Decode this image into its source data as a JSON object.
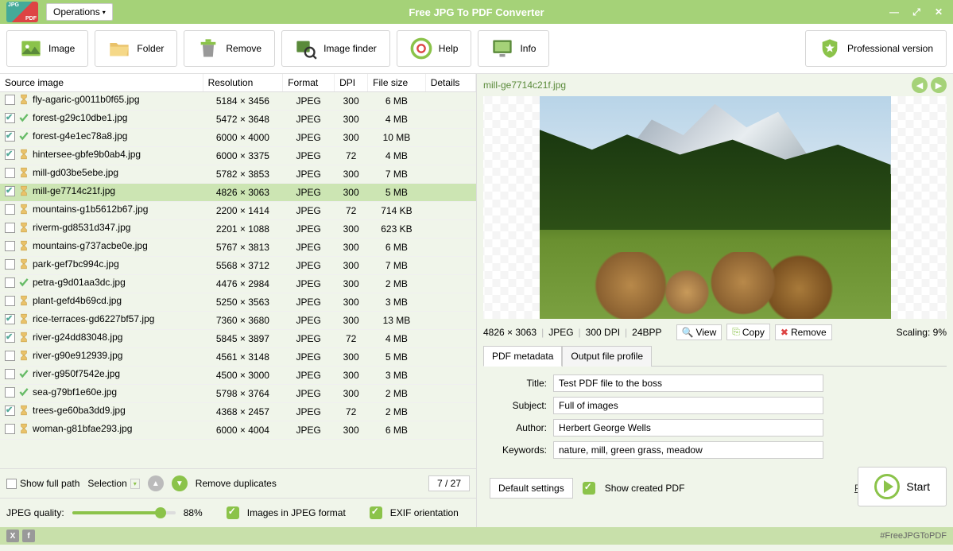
{
  "app_title": "Free JPG To PDF Converter",
  "operations_label": "Operations",
  "toolbar": {
    "image": "Image",
    "folder": "Folder",
    "remove": "Remove",
    "finder": "Image finder",
    "help": "Help",
    "info": "Info",
    "pro": "Professional version"
  },
  "columns": {
    "source": "Source image",
    "resolution": "Resolution",
    "format": "Format",
    "dpi": "DPI",
    "filesize": "File size",
    "details": "Details"
  },
  "rows": [
    {
      "chk": false,
      "st": "wait",
      "name": "fly-agaric-g0011b0f65.jpg",
      "res": "5184 × 3456",
      "fmt": "JPEG",
      "dpi": "300",
      "size": "6 MB"
    },
    {
      "chk": true,
      "st": "ready",
      "name": "forest-g29c10dbe1.jpg",
      "res": "5472 × 3648",
      "fmt": "JPEG",
      "dpi": "300",
      "size": "4 MB"
    },
    {
      "chk": true,
      "st": "ready",
      "name": "forest-g4e1ec78a8.jpg",
      "res": "6000 × 4000",
      "fmt": "JPEG",
      "dpi": "300",
      "size": "10 MB"
    },
    {
      "chk": true,
      "st": "wait",
      "name": "hintersee-gbfe9b0ab4.jpg",
      "res": "6000 × 3375",
      "fmt": "JPEG",
      "dpi": "72",
      "size": "4 MB"
    },
    {
      "chk": false,
      "st": "wait",
      "name": "mill-gd03be5ebe.jpg",
      "res": "5782 × 3853",
      "fmt": "JPEG",
      "dpi": "300",
      "size": "7 MB"
    },
    {
      "chk": true,
      "st": "wait",
      "name": "mill-ge7714c21f.jpg",
      "res": "4826 × 3063",
      "fmt": "JPEG",
      "dpi": "300",
      "size": "5 MB",
      "sel": true
    },
    {
      "chk": false,
      "st": "wait",
      "name": "mountains-g1b5612b67.jpg",
      "res": "2200 × 1414",
      "fmt": "JPEG",
      "dpi": "72",
      "size": "714 KB"
    },
    {
      "chk": false,
      "st": "wait",
      "name": "riverm-gd8531d347.jpg",
      "res": "2201 × 1088",
      "fmt": "JPEG",
      "dpi": "300",
      "size": "623 KB"
    },
    {
      "chk": false,
      "st": "wait",
      "name": "mountains-g737acbe0e.jpg",
      "res": "5767 × 3813",
      "fmt": "JPEG",
      "dpi": "300",
      "size": "6 MB"
    },
    {
      "chk": false,
      "st": "wait",
      "name": "park-gef7bc994c.jpg",
      "res": "5568 × 3712",
      "fmt": "JPEG",
      "dpi": "300",
      "size": "7 MB"
    },
    {
      "chk": false,
      "st": "ready",
      "name": "petra-g9d01aa3dc.jpg",
      "res": "4476 × 2984",
      "fmt": "JPEG",
      "dpi": "300",
      "size": "2 MB"
    },
    {
      "chk": false,
      "st": "wait",
      "name": "plant-gefd4b69cd.jpg",
      "res": "5250 × 3563",
      "fmt": "JPEG",
      "dpi": "300",
      "size": "3 MB"
    },
    {
      "chk": true,
      "st": "wait",
      "name": "rice-terraces-gd6227bf57.jpg",
      "res": "7360 × 3680",
      "fmt": "JPEG",
      "dpi": "300",
      "size": "13 MB"
    },
    {
      "chk": true,
      "st": "wait",
      "name": "river-g24dd83048.jpg",
      "res": "5845 × 3897",
      "fmt": "JPEG",
      "dpi": "72",
      "size": "4 MB"
    },
    {
      "chk": false,
      "st": "wait",
      "name": "river-g90e912939.jpg",
      "res": "4561 × 3148",
      "fmt": "JPEG",
      "dpi": "300",
      "size": "5 MB"
    },
    {
      "chk": false,
      "st": "ready",
      "name": "river-g950f7542e.jpg",
      "res": "4500 × 3000",
      "fmt": "JPEG",
      "dpi": "300",
      "size": "3 MB"
    },
    {
      "chk": false,
      "st": "ready",
      "name": "sea-g79bf1e60e.jpg",
      "res": "5798 × 3764",
      "fmt": "JPEG",
      "dpi": "300",
      "size": "2 MB"
    },
    {
      "chk": true,
      "st": "wait",
      "name": "trees-ge60ba3dd9.jpg",
      "res": "4368 × 2457",
      "fmt": "JPEG",
      "dpi": "72",
      "size": "2 MB"
    },
    {
      "chk": false,
      "st": "wait",
      "name": "woman-g81bfae293.jpg",
      "res": "6000 × 4004",
      "fmt": "JPEG",
      "dpi": "300",
      "size": "6 MB"
    }
  ],
  "footer": {
    "show_full_path": "Show full path",
    "selection": "Selection",
    "remove_dupes": "Remove duplicates",
    "counter": "7 / 27",
    "quality_label": "JPEG quality:",
    "quality_value": "88%",
    "images_jpeg": "Images in JPEG format",
    "exif": "EXIF orientation"
  },
  "preview": {
    "filename": "mill-ge7714c21f.jpg",
    "info_res": "4826 × 3063",
    "info_fmt": "JPEG",
    "info_dpi": "300 DPI",
    "info_bpp": "24BPP",
    "view": "View",
    "copy": "Copy",
    "remove": "Remove",
    "scaling": "Scaling: 9%"
  },
  "tabs": {
    "metadata": "PDF metadata",
    "output": "Output file profile"
  },
  "form": {
    "title_label": "Title:",
    "title_val": "Test PDF file to the boss",
    "subject_label": "Subject:",
    "subject_val": "Full of images",
    "author_label": "Author:",
    "author_val": "Herbert George Wells",
    "keywords_label": "Keywords:",
    "keywords_val": "nature, mill, green grass, meadow"
  },
  "right_footer": {
    "defaults": "Default settings",
    "show_pdf": "Show created PDF",
    "pro": "Professional version",
    "start": "Start"
  },
  "hashtag": "#FreeJPGToPDF"
}
